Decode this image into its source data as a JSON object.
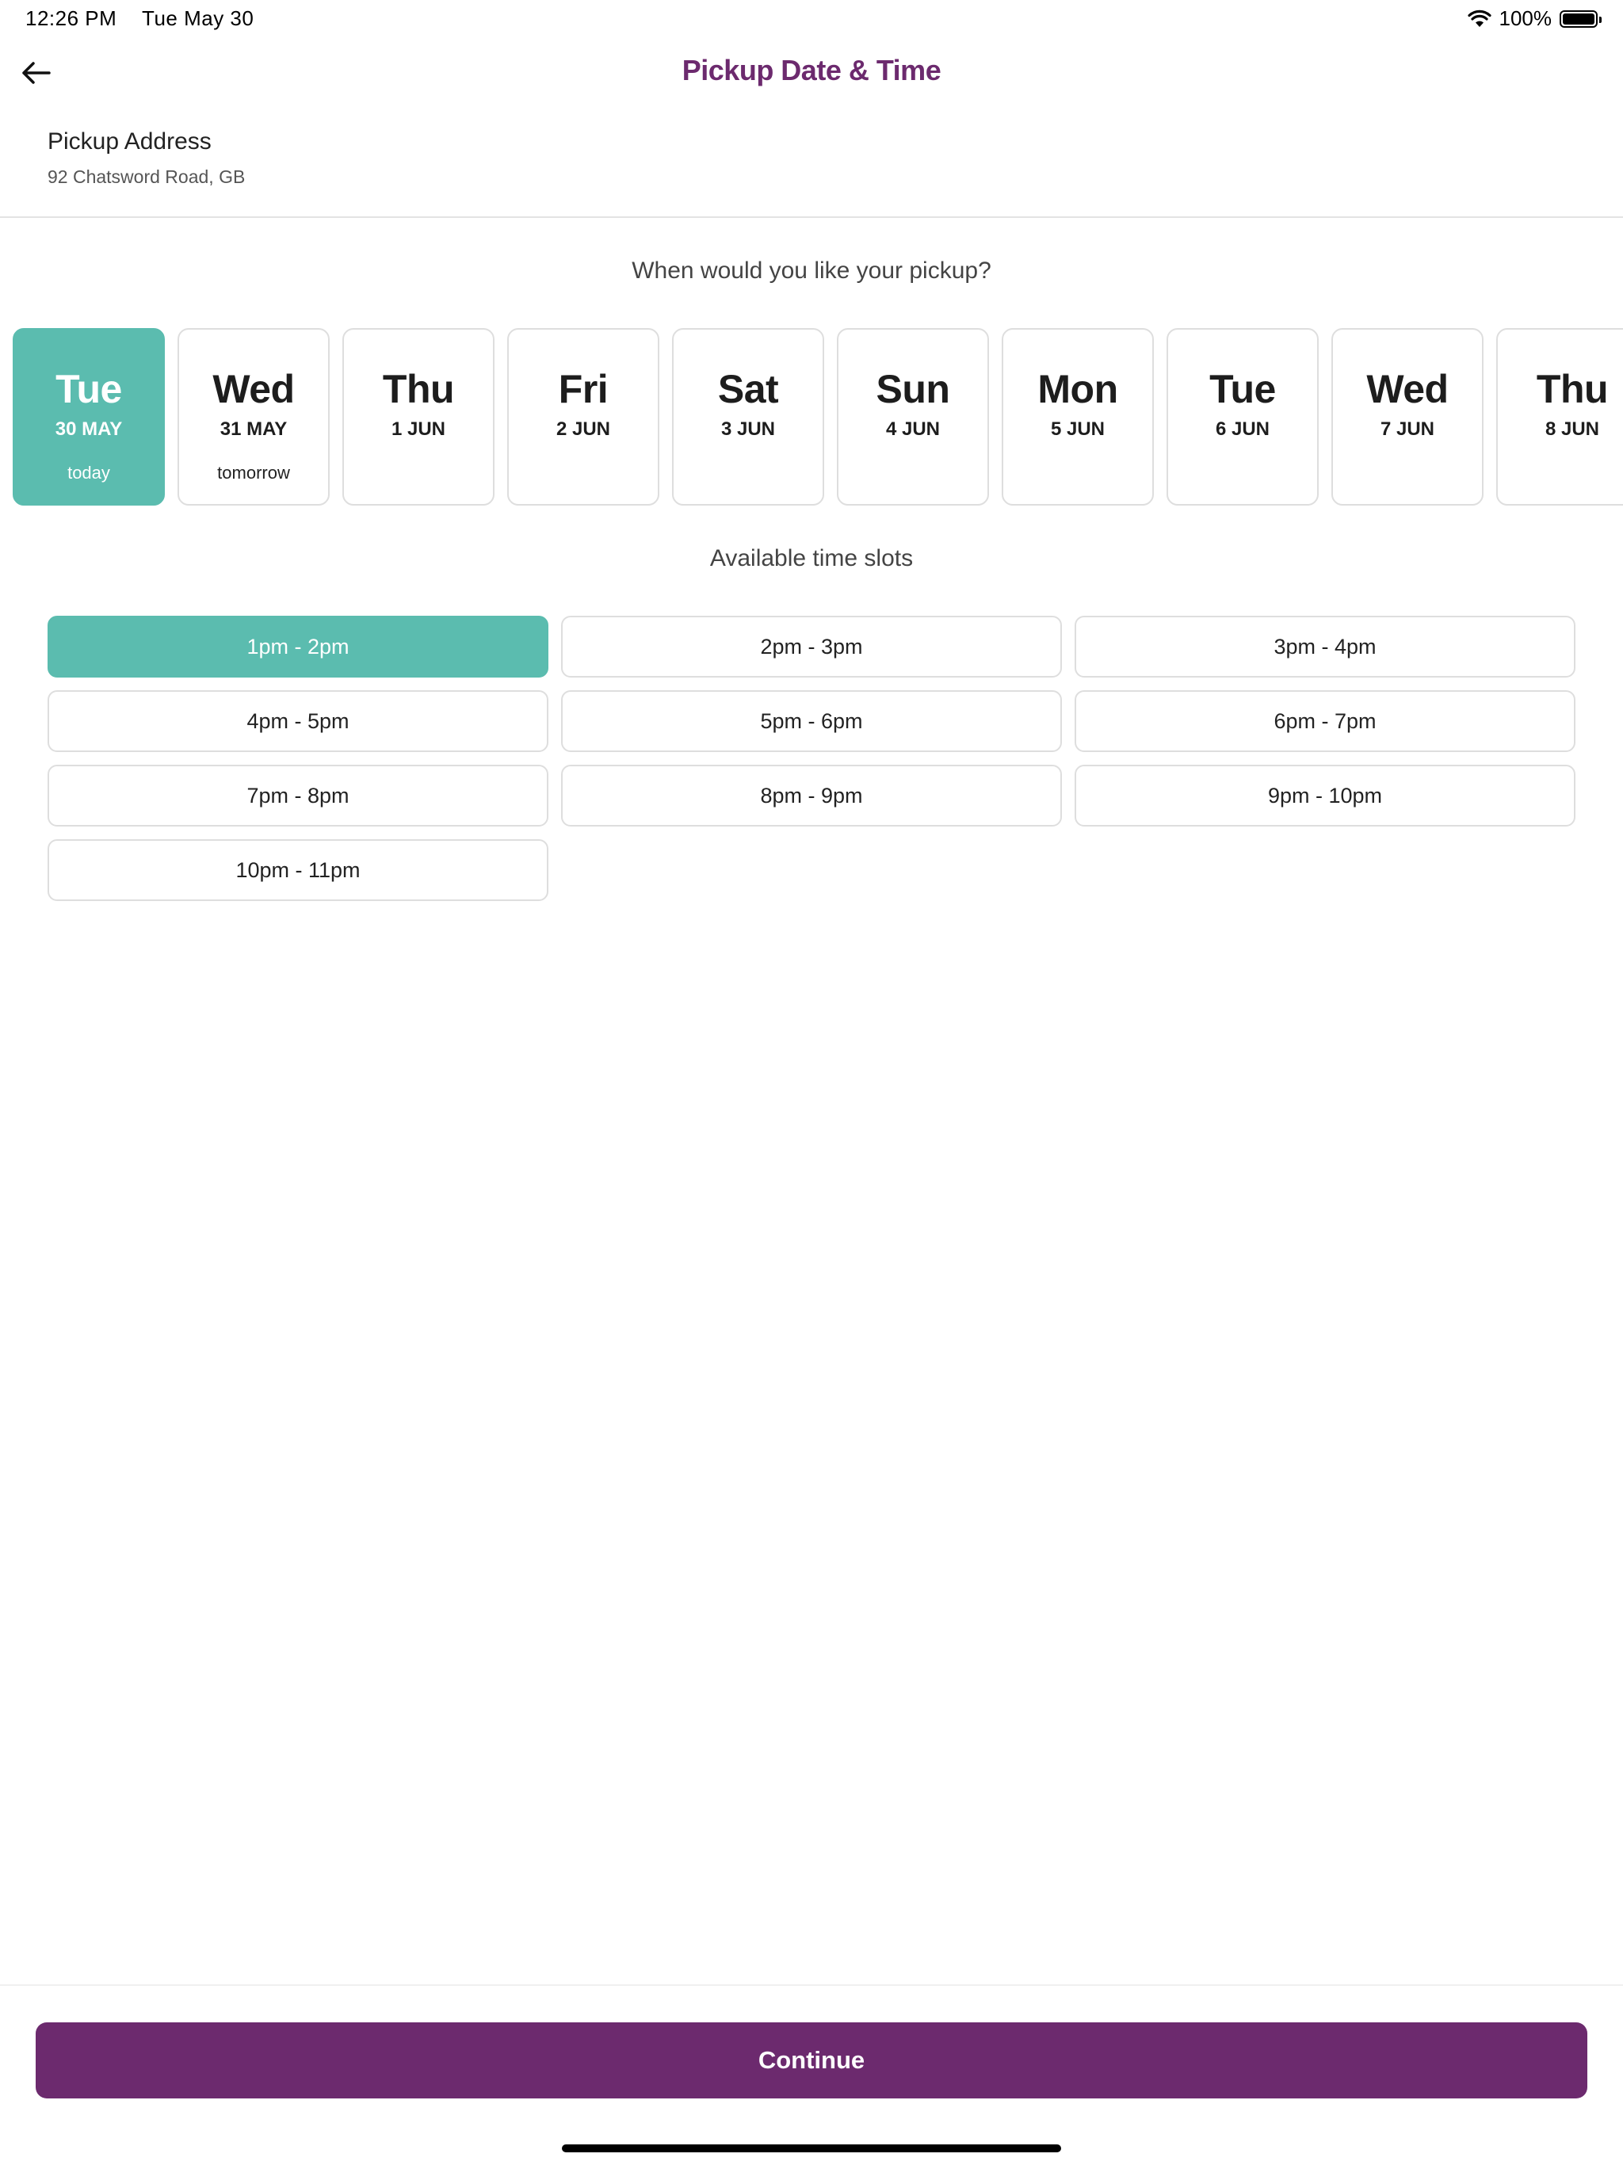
{
  "status_bar": {
    "time": "12:26 PM",
    "date": "Tue May 30",
    "battery": "100%",
    "battery_level": 1.0
  },
  "header": {
    "title": "Pickup Date & Time"
  },
  "address": {
    "label": "Pickup Address",
    "value": "92 Chatsword Road, GB"
  },
  "question": "When would you like your pickup?",
  "days": [
    {
      "name": "Tue",
      "date": "30 MAY",
      "note": "today",
      "selected": true
    },
    {
      "name": "Wed",
      "date": "31 MAY",
      "note": "tomorrow",
      "selected": false
    },
    {
      "name": "Thu",
      "date": "1 JUN",
      "note": "",
      "selected": false
    },
    {
      "name": "Fri",
      "date": "2 JUN",
      "note": "",
      "selected": false
    },
    {
      "name": "Sat",
      "date": "3 JUN",
      "note": "",
      "selected": false
    },
    {
      "name": "Sun",
      "date": "4 JUN",
      "note": "",
      "selected": false
    },
    {
      "name": "Mon",
      "date": "5 JUN",
      "note": "",
      "selected": false
    },
    {
      "name": "Tue",
      "date": "6 JUN",
      "note": "",
      "selected": false
    },
    {
      "name": "Wed",
      "date": "7 JUN",
      "note": "",
      "selected": false
    },
    {
      "name": "Thu",
      "date": "8 JUN",
      "note": "",
      "selected": false
    }
  ],
  "slots_title": "Available time slots",
  "slots": [
    {
      "label": "1pm - 2pm",
      "selected": true
    },
    {
      "label": "2pm - 3pm",
      "selected": false
    },
    {
      "label": "3pm - 4pm",
      "selected": false
    },
    {
      "label": "4pm - 5pm",
      "selected": false
    },
    {
      "label": "5pm - 6pm",
      "selected": false
    },
    {
      "label": "6pm - 7pm",
      "selected": false
    },
    {
      "label": "7pm - 8pm",
      "selected": false
    },
    {
      "label": "8pm - 9pm",
      "selected": false
    },
    {
      "label": "9pm - 10pm",
      "selected": false
    },
    {
      "label": "10pm - 11pm",
      "selected": false
    }
  ],
  "continue_label": "Continue",
  "colors": {
    "accent": "#5bbcaf",
    "brand": "#6c2a6e",
    "border": "#dedede"
  }
}
